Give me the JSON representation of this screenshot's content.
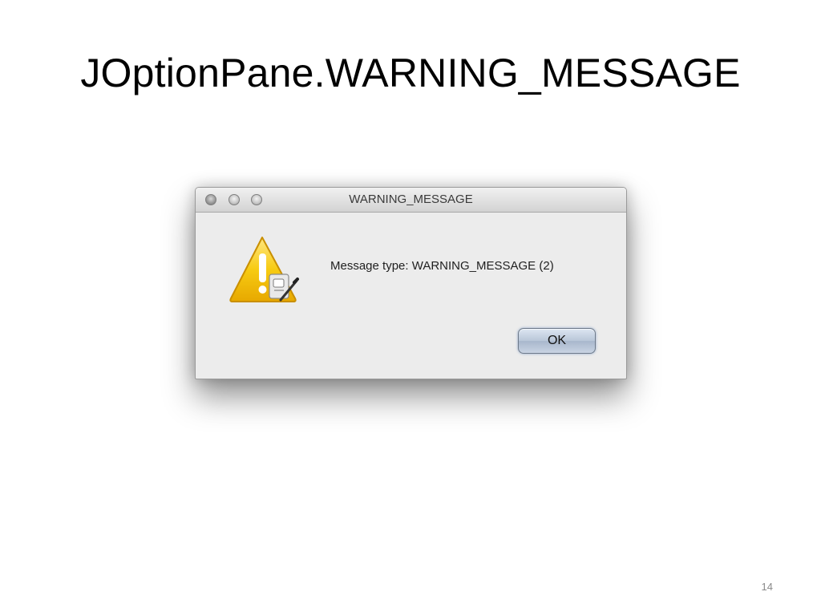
{
  "slide": {
    "title": "JOptionPane.WARNING_MESSAGE",
    "page_number": "14"
  },
  "dialog": {
    "window_title": "WARNING_MESSAGE",
    "message": "Message type: WARNING_MESSAGE (2)",
    "ok_label": "OK",
    "icon": "warning-triangle-icon",
    "traffic_lights": [
      "close-button",
      "minimize-button",
      "zoom-button"
    ]
  },
  "colors": {
    "warning_yellow": "#f5c400",
    "button_blue": "#b9c6d8",
    "dialog_bg": "#ececec"
  }
}
